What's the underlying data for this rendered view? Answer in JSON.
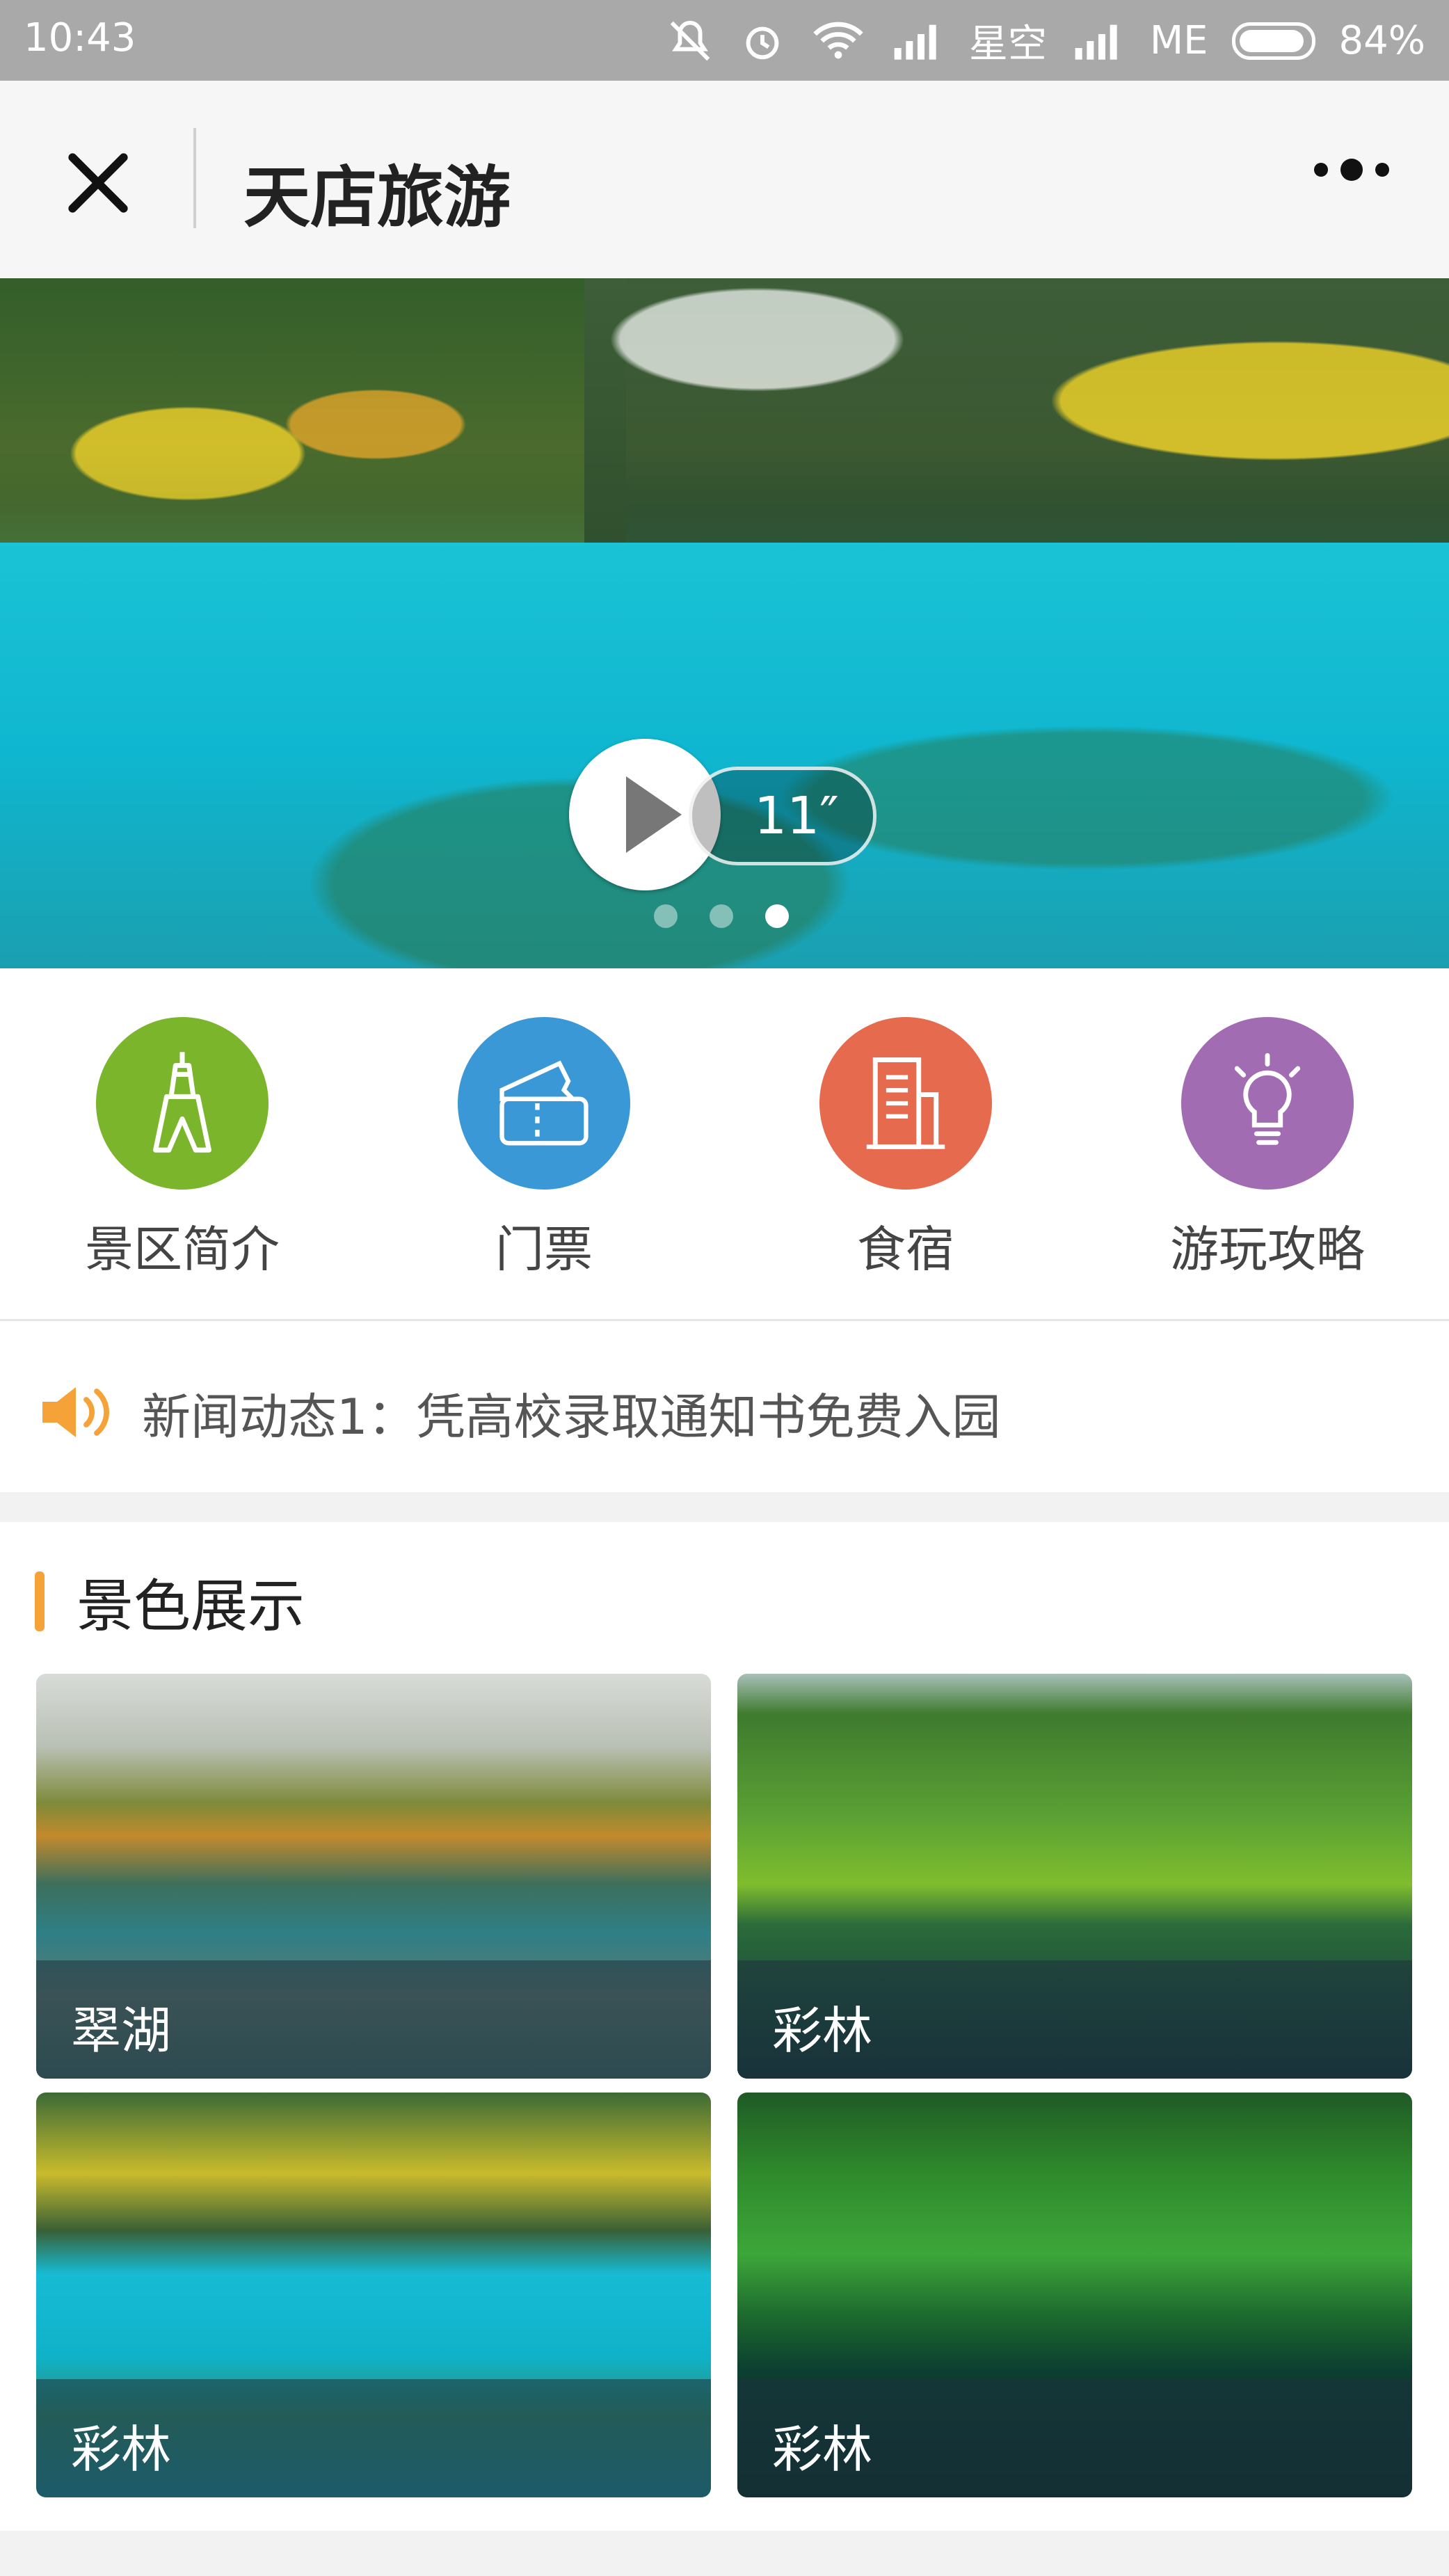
{
  "status_bar": {
    "time": "10:43",
    "carrier1": "星空",
    "carrier2": "ME",
    "battery": "84%"
  },
  "header": {
    "title": "天店旅游"
  },
  "hero": {
    "duration": "11″",
    "slide_count": 3,
    "active_slide": 3
  },
  "menu": {
    "items": [
      {
        "label": "景区简介",
        "icon": "tower-icon",
        "color": "#7ab52b"
      },
      {
        "label": "门票",
        "icon": "ticket-icon",
        "color": "#3a98d6"
      },
      {
        "label": "食宿",
        "icon": "building-icon",
        "color": "#e66a4d"
      },
      {
        "label": "游玩攻略",
        "icon": "lightbulb-icon",
        "color": "#a16cb1"
      }
    ]
  },
  "news": {
    "text": "新闻动态1：凭高校录取通知书免费入园"
  },
  "gallery": {
    "title": "景色展示",
    "tiles": [
      {
        "caption": "翠湖"
      },
      {
        "caption": "彩林"
      },
      {
        "caption": "彩林"
      },
      {
        "caption": "彩林"
      }
    ]
  },
  "colors": {
    "accent": "#f5a238",
    "status_bar": "#a9a9a9"
  }
}
